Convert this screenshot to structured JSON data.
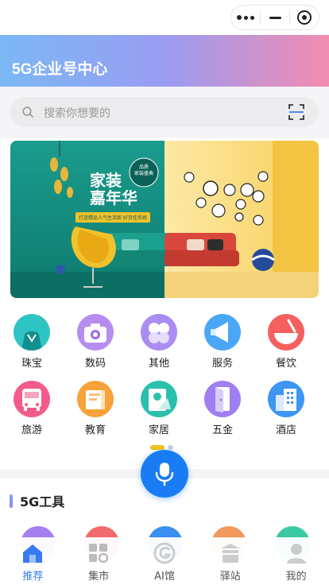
{
  "header": {
    "title": "5G企业号中心"
  },
  "search": {
    "placeholder": "搜索你想要的"
  },
  "banner": {
    "headline_1": "家装",
    "headline_2": "嘉年华",
    "badge_1": "品质",
    "badge_2": "家装盛典",
    "subline": "打造精品人气生活家 好货任你挑"
  },
  "categories": [
    {
      "label": "珠宝",
      "color": "#2fc4c4",
      "icon": "jewelry-icon"
    },
    {
      "label": "数码",
      "color": "#b68cf0",
      "icon": "camera-icon"
    },
    {
      "label": "其他",
      "color": "#a98df2",
      "icon": "other-icon"
    },
    {
      "label": "服务",
      "color": "#4aa7f5",
      "icon": "service-icon"
    },
    {
      "label": "餐饮",
      "color": "#f5605f",
      "icon": "food-icon"
    },
    {
      "label": "旅游",
      "color": "#f55b8a",
      "icon": "travel-icon"
    },
    {
      "label": "教育",
      "color": "#f7a23a",
      "icon": "education-icon"
    },
    {
      "label": "家居",
      "color": "#2bbfae",
      "icon": "home-icon"
    },
    {
      "label": "五金",
      "color": "#9f7ef2",
      "icon": "hardware-icon"
    },
    {
      "label": "酒店",
      "color": "#3d95f4",
      "icon": "hotel-icon"
    }
  ],
  "tools": {
    "title": "5G工具"
  },
  "tabbar": [
    {
      "label": "推荐",
      "active": true
    },
    {
      "label": "集市",
      "active": false
    },
    {
      "label": "AI馆",
      "active": false
    },
    {
      "label": "驿站",
      "active": false
    },
    {
      "label": "我的",
      "active": false
    }
  ],
  "colors": {
    "accent": "#1a7cf4",
    "active_tab": "#3a7af0"
  }
}
